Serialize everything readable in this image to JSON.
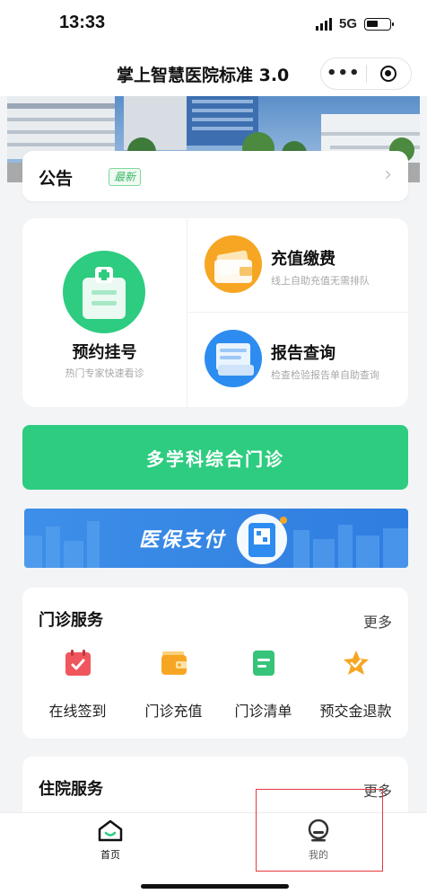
{
  "status": {
    "time": "13:33",
    "network": "5G"
  },
  "navbar": {
    "title": "掌上智慧医院标准 3.0",
    "more_icon": "more-dots-icon",
    "close_icon": "target-circle-icon"
  },
  "notice": {
    "label": "公告",
    "tag": "最新"
  },
  "services": {
    "appointment": {
      "title": "预约挂号",
      "subtitle": "热门专家快速看诊"
    },
    "recharge": {
      "title": "充值缴费",
      "subtitle": "线上自助充值无需排队"
    },
    "report": {
      "title": "报告查询",
      "subtitle": "检查检验报告单自助查询"
    }
  },
  "clinic_button": {
    "label": "多学科综合门诊"
  },
  "insurance_banner": {
    "text": "医保支付"
  },
  "outpatient": {
    "title": "门诊服务",
    "more": "更多",
    "items": [
      {
        "label": "在线签到",
        "icon": "calendar-check-icon",
        "color": "#f0565e"
      },
      {
        "label": "门诊充值",
        "icon": "wallet-icon",
        "color": "#f6a623"
      },
      {
        "label": "门诊清单",
        "icon": "list-document-icon",
        "color": "#35c47a"
      },
      {
        "label": "预交金退款",
        "icon": "star-badge-icon",
        "color": "#f6a623"
      }
    ]
  },
  "inpatient": {
    "title": "住院服务",
    "more": "更多"
  },
  "tabbar": {
    "home": "首页",
    "mine": "我的"
  },
  "colors": {
    "primary_green": "#2ecc80",
    "highlight_red": "#e8393d",
    "insurance_blue": "#2d8cf0"
  }
}
